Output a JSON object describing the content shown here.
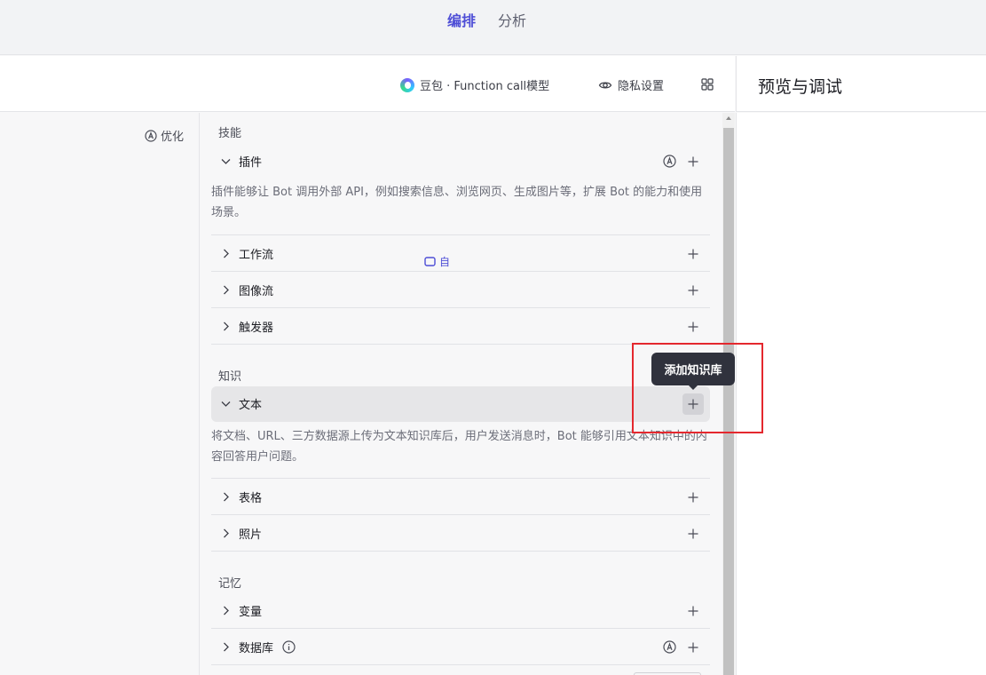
{
  "topbar": {
    "tabs": [
      {
        "label": "编排",
        "active": true
      },
      {
        "label": "分析",
        "active": false
      }
    ]
  },
  "toolbar": {
    "model_label": "豆包 · Function call模型",
    "privacy_label": "隐私设置"
  },
  "preview": {
    "title": "预览与调试"
  },
  "left": {
    "optimize_label": "优化"
  },
  "skills": {
    "title": "技能",
    "plugin": {
      "label": "插件",
      "desc": "插件能够让 Bot 调用外部 API，例如搜索信息、浏览网页、生成图片等，扩展 Bot 的能力和使用场景。"
    },
    "workflow_label": "工作流",
    "imageflow_label": "图像流",
    "trigger_label": "触发器"
  },
  "knowledge": {
    "title": "知识",
    "auto_label": "自",
    "text": {
      "label": "文本",
      "desc": "将文档、URL、三方数据源上传为文本知识库后，用户发送消息时，Bot 能够引用文本知识中的内容回答用户问题。"
    },
    "table_label": "表格",
    "photo_label": "照片"
  },
  "memory": {
    "title": "记忆",
    "variable_label": "变量",
    "database_label": "数据库"
  },
  "tooltip": {
    "text": "添加知识库"
  },
  "colors": {
    "accent": "#4e4ed6",
    "highlight_border": "#e4282e",
    "tooltip_bg": "#30323d"
  }
}
